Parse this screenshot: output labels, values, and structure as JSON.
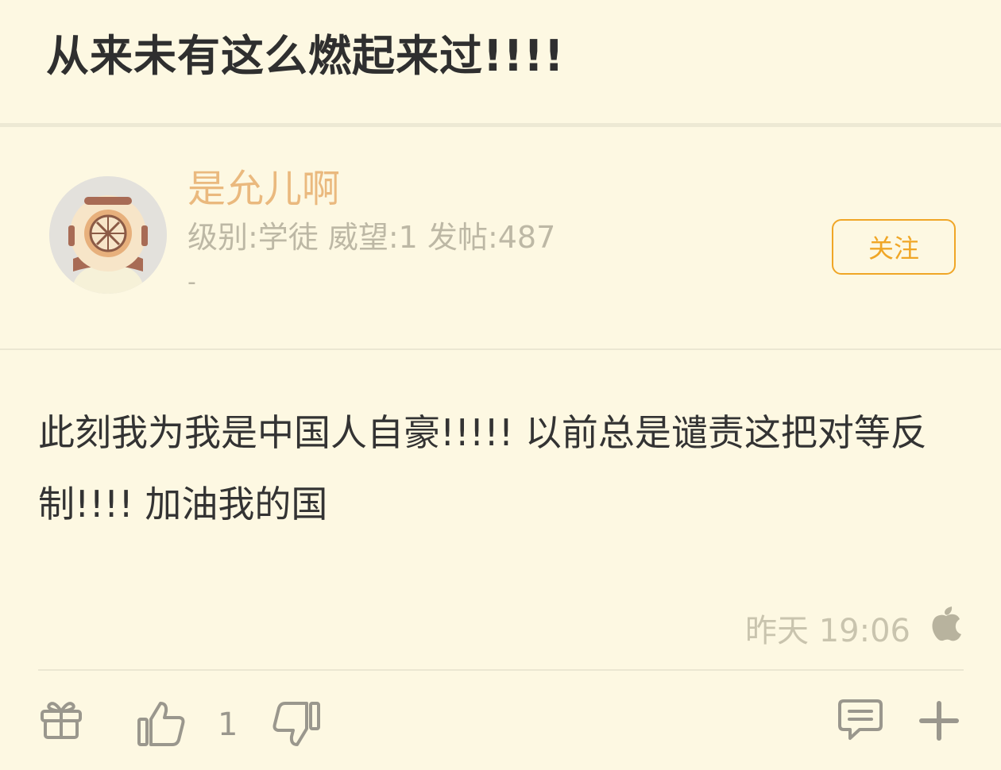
{
  "thread": {
    "title": "从来未有这么燃起来过!!!!"
  },
  "author": {
    "name": "是允儿啊",
    "stats": "级别:学徒 威望:1 发帖:487",
    "extra": "-",
    "follow_label": "关注"
  },
  "post": {
    "body": "此刻我为我是中国人自豪!!!!! 以前总是谴责这把对等反制!!!! 加油我的国",
    "time": "昨天 19:06",
    "device_icon": "apple-icon"
  },
  "actions": {
    "like_count": "1",
    "icons": [
      "gift-icon",
      "thumbs-up-icon",
      "thumbs-down-icon",
      "comment-icon",
      "plus-icon"
    ]
  },
  "colors": {
    "background": "#fdf8e2",
    "username": "#eab97e",
    "follow_accent": "#f0a626",
    "meta_text": "#bdb8a5",
    "body_text": "#333333"
  }
}
